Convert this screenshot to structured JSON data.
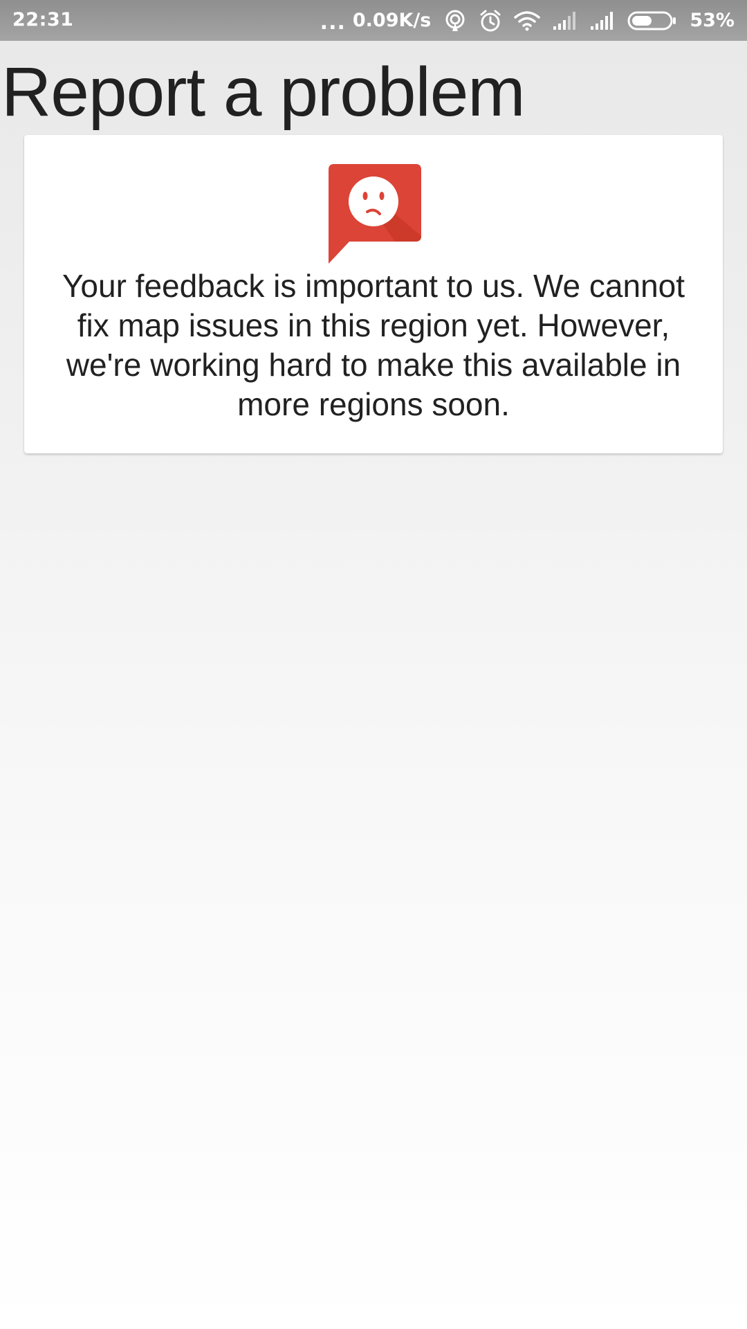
{
  "status_bar": {
    "time": "22:31",
    "more_dots": "...",
    "network_speed": "0.09K/s",
    "battery_percent": "53%",
    "battery_level": 0.53,
    "icons": [
      "hotspot-icon",
      "alarm-icon",
      "wifi-icon",
      "signal-icon",
      "signal-icon",
      "battery-icon"
    ]
  },
  "page": {
    "title": "Report a problem"
  },
  "card": {
    "icon": "sad-feedback-icon",
    "icon_color": "#db4437",
    "message": "Your feedback is important to us. We cannot fix map issues in this region yet. However, we're working hard to make this available in more regions soon."
  }
}
